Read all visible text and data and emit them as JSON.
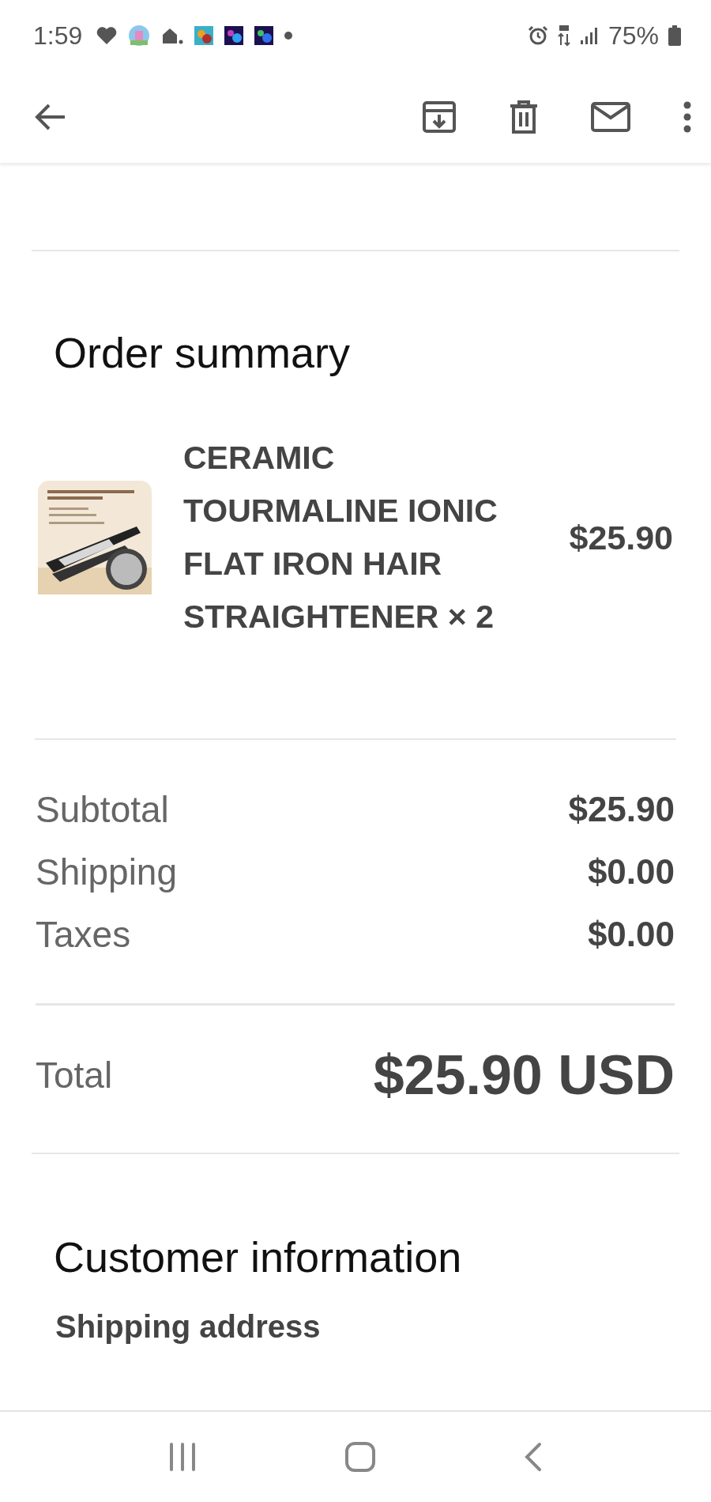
{
  "status_bar": {
    "time": "1:59",
    "battery": "75%"
  },
  "order_summary": {
    "title": "Order summary",
    "items": [
      {
        "name": "CERAMIC TOURMALINE IONIC FLAT IRON HAIR STRAIGHTENER × 2",
        "price": "$25.90"
      }
    ],
    "costs": [
      {
        "label": "Subtotal",
        "value": "$25.90"
      },
      {
        "label": "Shipping",
        "value": "$0.00"
      },
      {
        "label": "Taxes",
        "value": "$0.00"
      }
    ],
    "total": {
      "label": "Total",
      "value": "$25.90 USD"
    }
  },
  "customer_information": {
    "title": "Customer information",
    "subtitle": "Shipping address"
  }
}
